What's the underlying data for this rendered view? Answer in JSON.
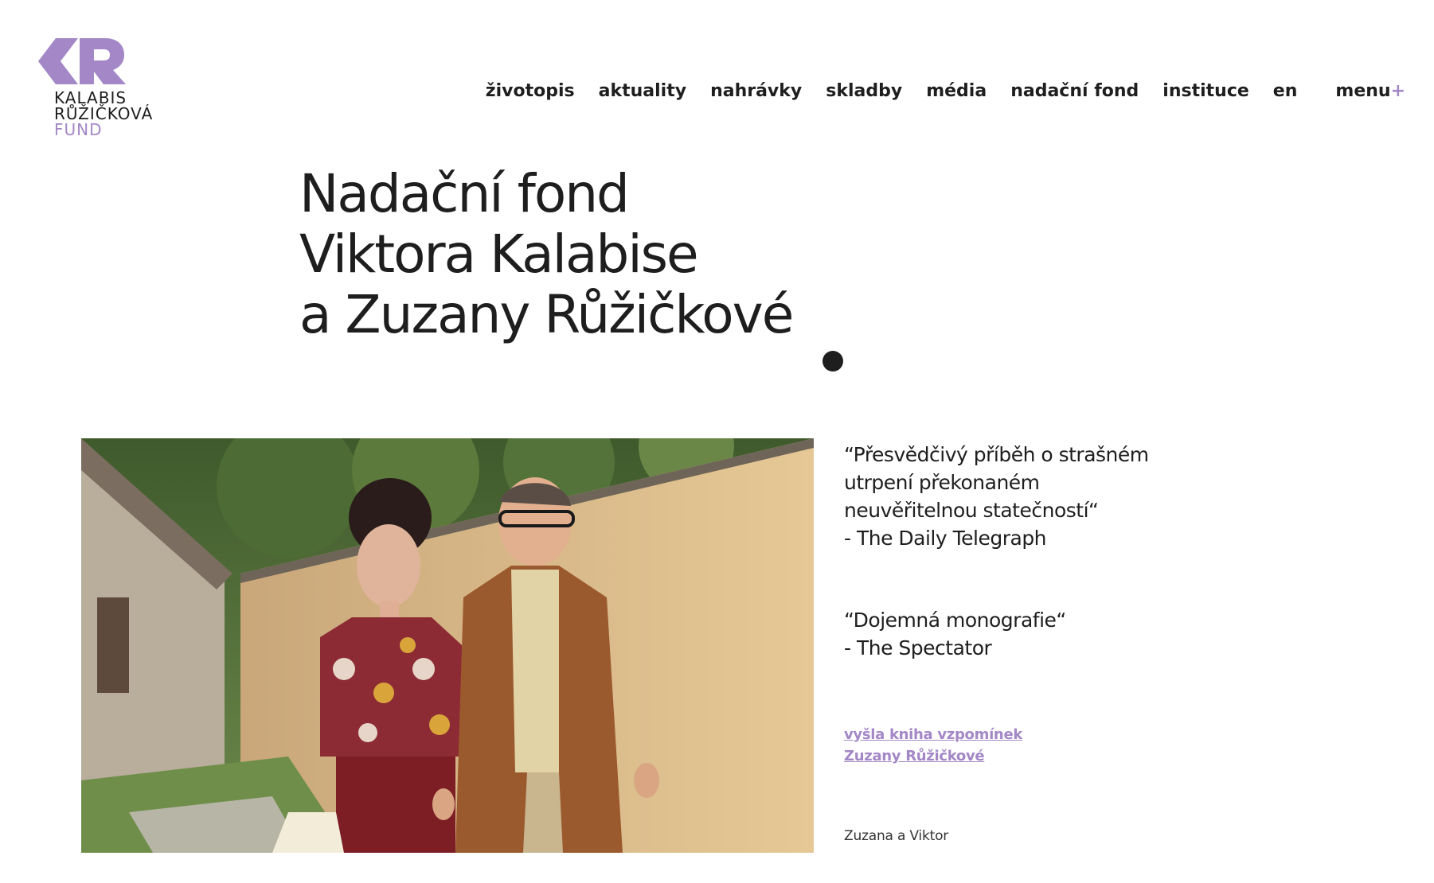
{
  "logo": {
    "line1": "KALABIS",
    "line2": "RŮŽIČKOVÁ",
    "line3": "FUND",
    "accent_color": "#a387c6"
  },
  "nav": {
    "items": [
      {
        "label": "životopis"
      },
      {
        "label": "aktuality"
      },
      {
        "label": "nahrávky"
      },
      {
        "label": "skladby"
      },
      {
        "label": "média"
      },
      {
        "label": "nadační fond"
      },
      {
        "label": "instituce"
      },
      {
        "label": "en"
      }
    ],
    "menu_label": "menu",
    "menu_plus": "+"
  },
  "hero": {
    "title_lines": [
      "Nadační fond",
      "Viktora Kalabise",
      "a Zuzany Růžičkové"
    ]
  },
  "quotes": [
    {
      "text": "“Přesvědčivý příběh o strašném utrpení překonaném neuvěřitelnou statečností“",
      "source": "- The Daily Telegraph"
    },
    {
      "text": "“Dojemná monografie“",
      "source": "- The Spectator"
    }
  ],
  "book_link": "vyšla kniha vzpomínek Zuzany Růžičkové",
  "photo_caption": "Zuzana a Viktor",
  "colors": {
    "text": "#1e1e1e",
    "accent": "#a387c6",
    "background": "#ffffff"
  }
}
